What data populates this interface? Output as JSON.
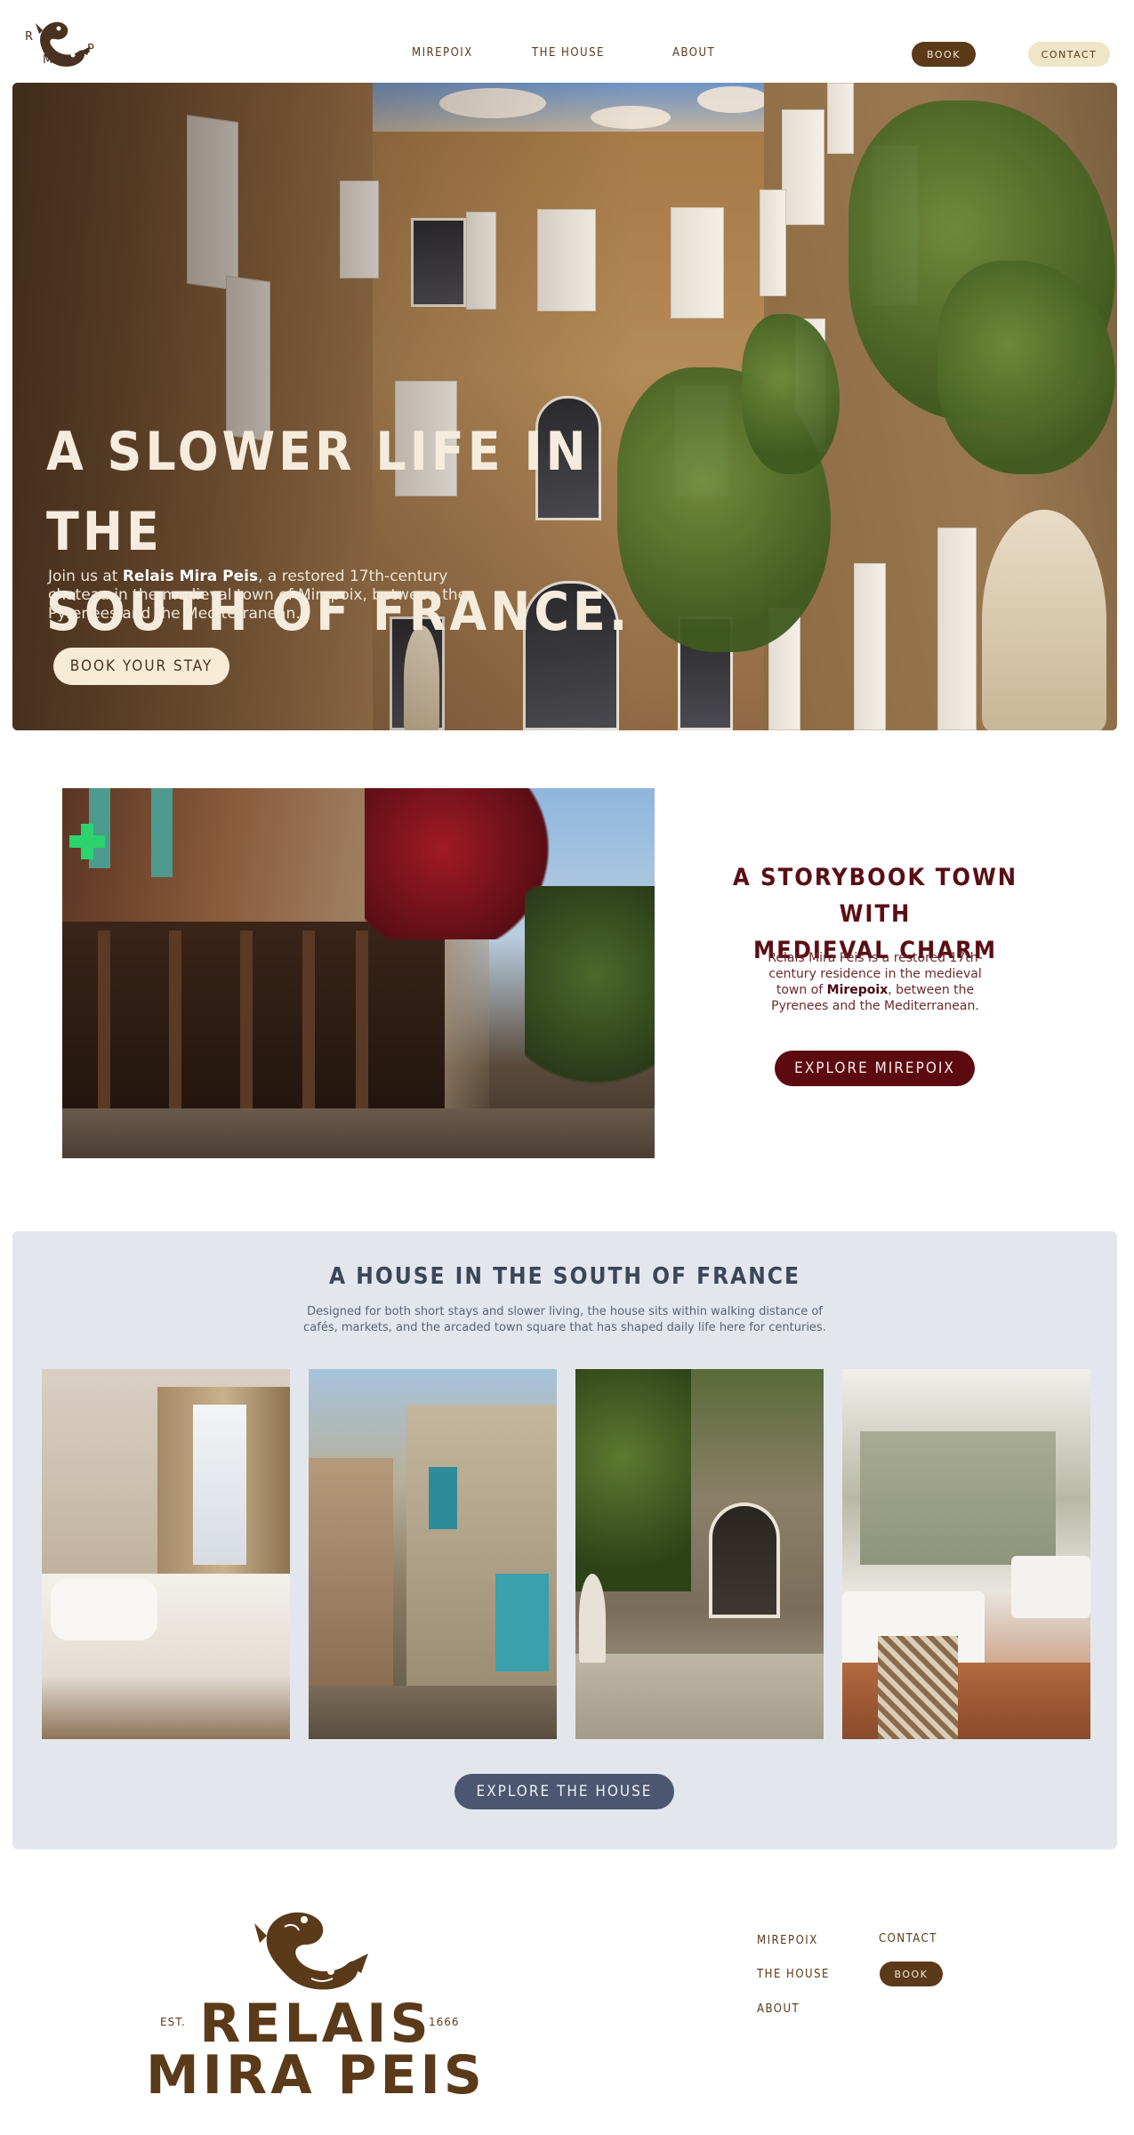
{
  "brand": {
    "logo_letters": [
      "R",
      "M",
      "P"
    ],
    "footer_line1": "RELAIS",
    "footer_line2": "MIRA PEIS",
    "est": "EST.",
    "year": "1666",
    "colors": {
      "brown": "#5b3a1a",
      "cream": "#efe5c9",
      "wine": "#5c0a10",
      "slate": "#4d5670"
    }
  },
  "header": {
    "nav": [
      {
        "label": "MIREPOIX"
      },
      {
        "label": "THE HOUSE"
      },
      {
        "label": "ABOUT"
      }
    ],
    "book_label": "BOOK",
    "contact_label": "CONTACT"
  },
  "hero": {
    "title_line1": "A SLOWER LIFE IN THE",
    "title_line2": "SOUTH OF FRANCE.",
    "sub_pre": "Join us at ",
    "sub_bold": "Relais Mira Peis",
    "sub_post": ", a restored 17th-century chateau in the medieval town of Mirepoix, between the Pyrenees and the Mediterranean.",
    "cta_label": "BOOK YOUR STAY"
  },
  "storybook": {
    "title_line1": "A STORYBOOK TOWN WITH",
    "title_line2": "MEDIEVAL CHARM",
    "body_pre": "Relais Mira Peis is a restored 17th-century residence in the medieval town of ",
    "body_bold": "Mirepoix",
    "body_post": ", between the Pyrenees and the Mediterranean.",
    "cta_label": "EXPLORE MIREPOIX"
  },
  "house": {
    "title": "A HOUSE IN THE SOUTH OF FRANCE",
    "body": "Designed for both short stays and slower living, the house sits within walking distance of cafés, markets, and the arcaded town square that has shaped daily life here for centuries.",
    "cta_label": "EXPLORE THE HOUSE"
  },
  "footer": {
    "nav_col1": [
      "MIREPOIX",
      "THE HOUSE",
      "ABOUT"
    ],
    "contact_label": "CONTACT",
    "book_label": "BOOK"
  }
}
